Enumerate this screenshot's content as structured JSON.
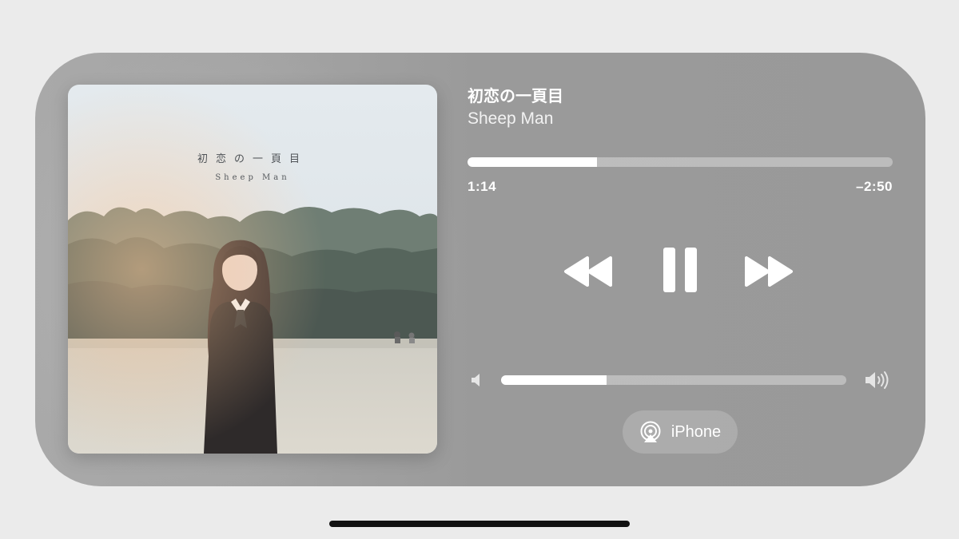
{
  "now_playing": {
    "title": "初恋の一頁目",
    "artist": "Sheep Man",
    "progress_fraction": 0.305
  },
  "artwork": {
    "title": "初恋の一頁目",
    "artist": "Sheep Man"
  },
  "time": {
    "elapsed": "1:14",
    "remaining": "–2:50"
  },
  "controls": {
    "rewind_icon": "backward-icon",
    "pause_icon": "pause-icon",
    "forward_icon": "forward-icon"
  },
  "volume": {
    "level_fraction": 0.305,
    "low_icon": "speaker-low-icon",
    "high_icon": "speaker-high-icon"
  },
  "output": {
    "device": "iPhone",
    "icon": "airplay-audio-icon"
  },
  "colors": {
    "card": "#a4a4a4",
    "screen_bg": "#ebebeb",
    "fill": "#ffffff"
  }
}
